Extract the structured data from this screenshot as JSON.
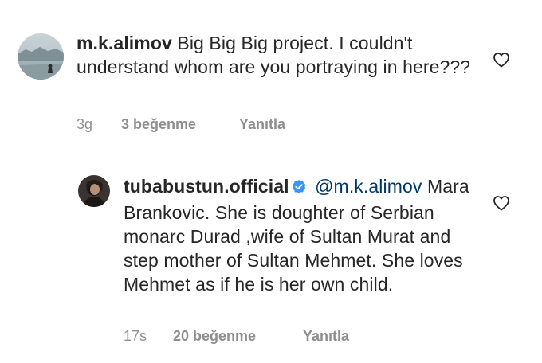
{
  "comments": [
    {
      "username": "m.k.alimov",
      "text": "Big Big Big project. I couldn't understand whom are you portraying in here???",
      "time": "3g",
      "likes": "3 beğenme",
      "reply": "Yanıtla"
    },
    {
      "username": "tubabustun.official",
      "verified": true,
      "mention": "@m.k.alimov",
      "text": "Mara Brankovic. She is doughter of Serbian monarc Durad ,wife of Sultan Murat and step mother of Sultan Mehmet. She loves Mehmet as if he is her own child.",
      "time": "17s",
      "likes": "20 beğenme",
      "reply": "Yanıtla"
    }
  ],
  "colors": {
    "text": "#262626",
    "meta": "#8e8e8e",
    "mention": "#00376b",
    "verified": "#3897f0"
  },
  "icons": [
    "heart-icon",
    "verified-badge-icon"
  ]
}
